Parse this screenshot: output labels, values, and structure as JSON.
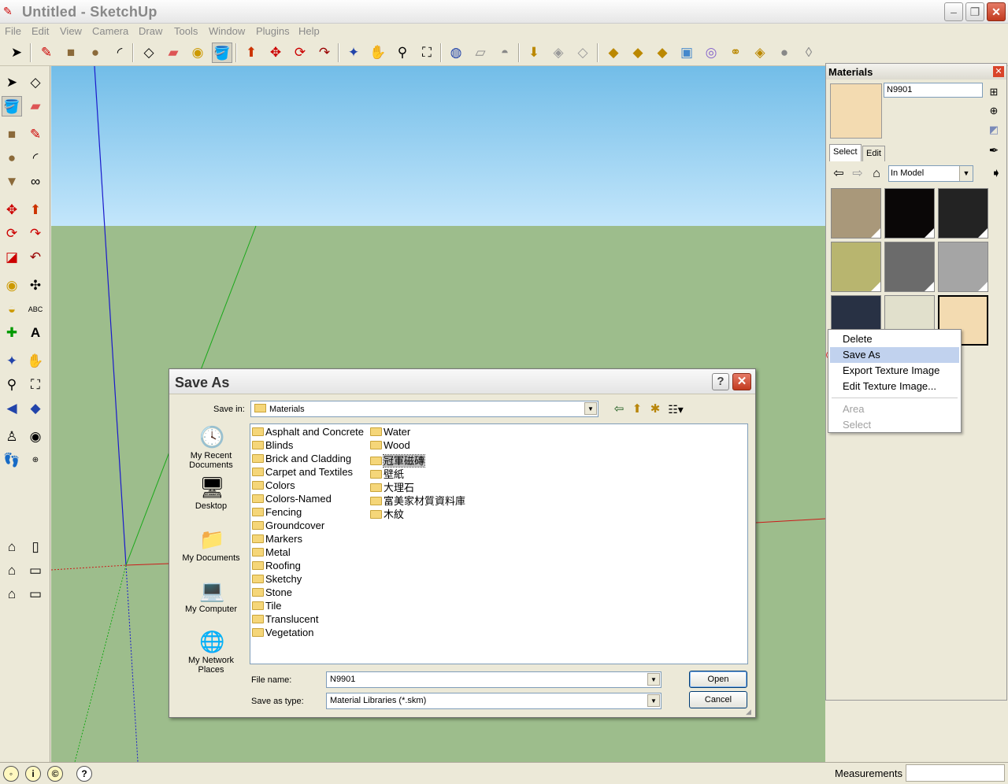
{
  "window": {
    "title": "Untitled - SketchUp",
    "minimize": "‒",
    "restore": "❐",
    "close": "✕"
  },
  "menu": [
    "File",
    "Edit",
    "View",
    "Camera",
    "Draw",
    "Tools",
    "Window",
    "Plugins",
    "Help"
  ],
  "status": {
    "measurements_label": "Measurements",
    "help_glyph": "?"
  },
  "materials": {
    "title": "Materials",
    "close_glyph": "✕",
    "name_value": "N9901",
    "tab_select": "Select",
    "tab_edit": "Edit",
    "collection": "In Model",
    "swatch_colors": [
      "#a9987a",
      "#0a0707",
      "#232323",
      "#b8b56f",
      "#6b6b6b",
      "#a5a5a5",
      "#283144",
      "#e1e0cc",
      "#f3dbb1"
    ],
    "selected_swatch_index": 8
  },
  "context_menu": {
    "items": [
      "Delete",
      "Save As",
      "Export Texture Image",
      "Edit Texture Image...",
      "Area",
      "Select"
    ],
    "highlighted": "Save As",
    "disabled": [
      "Area",
      "Select"
    ]
  },
  "dialog": {
    "title": "Save As",
    "help_glyph": "?",
    "close_glyph": "✕",
    "save_in_label": "Save in:",
    "save_in_value": "Materials",
    "places": [
      {
        "label": "My Recent Documents",
        "icon": "recent-documents-icon",
        "glyph": "🕓"
      },
      {
        "label": "Desktop",
        "icon": "desktop-icon",
        "glyph": "🖥"
      },
      {
        "label": "My Documents",
        "icon": "my-documents-icon",
        "glyph": "📁"
      },
      {
        "label": "My Computer",
        "icon": "my-computer-icon",
        "glyph": "💻"
      },
      {
        "label": "My Network Places",
        "icon": "network-places-icon",
        "glyph": "🌐"
      }
    ],
    "folders_col1": [
      "Asphalt and Concrete",
      "Blinds",
      "Brick and Cladding",
      "Carpet and Textiles",
      "Colors",
      "Colors-Named",
      "Fencing",
      "Groundcover",
      "Markers",
      "Metal",
      "Roofing",
      "Sketchy",
      "Stone",
      "Tile",
      "Translucent",
      "Vegetation"
    ],
    "folders_col2": [
      "Water",
      "Wood",
      "冠軍磁磚",
      "壁紙",
      "大理石",
      "富美家材質資料庫",
      "木紋"
    ],
    "selected_folder": "冠軍磁磚",
    "file_name_label": "File name:",
    "file_name_value": "N9901",
    "save_type_label": "Save as type:",
    "save_type_value": "Material Libraries (*.skm)",
    "open_button": "Open",
    "cancel_button": "Cancel"
  }
}
